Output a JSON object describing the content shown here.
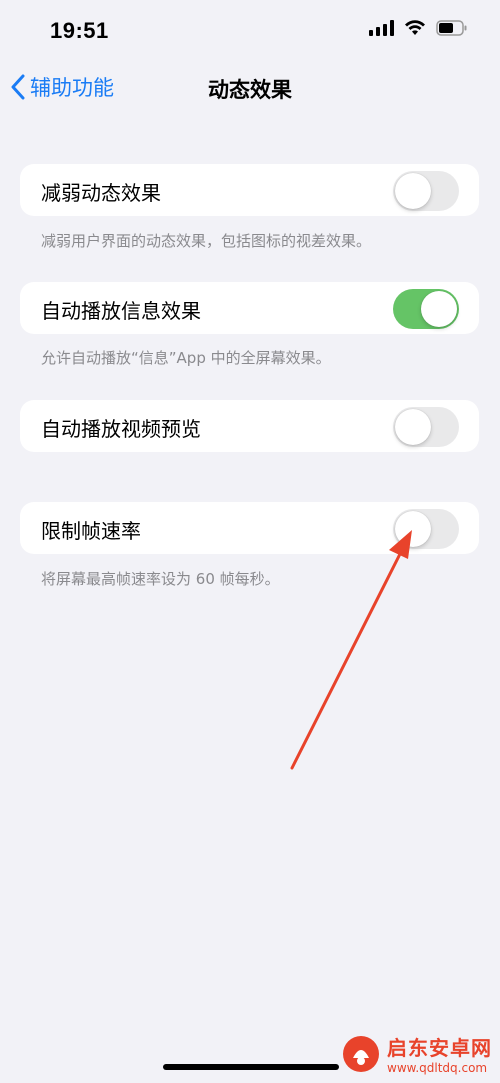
{
  "status_bar": {
    "time": "19:51"
  },
  "nav": {
    "back_label": "辅助功能",
    "title": "动态效果"
  },
  "settings": [
    {
      "label": "减弱动态效果",
      "enabled": false,
      "footer": "减弱用户界面的动态效果，包括图标的视差效果。"
    },
    {
      "label": "自动播放信息效果",
      "enabled": true,
      "footer": "允许自动播放“信息”App 中的全屏幕效果。"
    },
    {
      "label": "自动播放视频预览",
      "enabled": false,
      "footer": ""
    },
    {
      "label": "限制帧速率",
      "enabled": false,
      "footer": "将屏幕最高帧速率设为 60 帧每秒。"
    }
  ],
  "watermark": {
    "title": "启东安卓网",
    "url": "www.qdltdq.com"
  },
  "colors": {
    "accent": "#1a7cf5",
    "toggle_on": "#65c466",
    "annotation_arrow": "#e8432b"
  }
}
